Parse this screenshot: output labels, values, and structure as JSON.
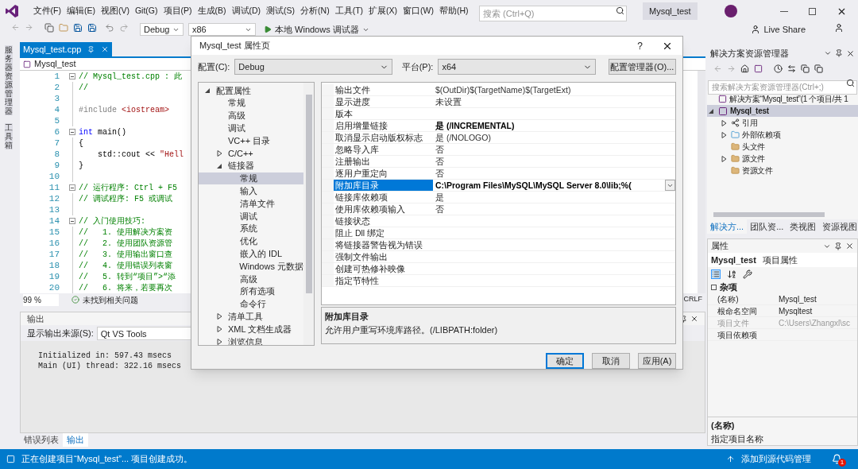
{
  "menu_bar": {
    "items": [
      "文件(F)",
      "编辑(E)",
      "视图(V)",
      "Git(G)",
      "项目(P)",
      "生成(B)",
      "调试(D)",
      "测试(S)",
      "分析(N)",
      "工具(T)",
      "扩展(X)",
      "窗口(W)",
      "帮助(H)"
    ],
    "search": {
      "placeholder": "搜索 (Ctrl+Q)"
    },
    "solution_name": "Mysql_test"
  },
  "toolbar": {
    "configuration": "Debug",
    "platform": "x86",
    "run_button": "本地 Windows 调试器",
    "live_share": "Live Share"
  },
  "side_tabs": [
    "服务器资源管理器",
    "工具箱"
  ],
  "editor": {
    "tabs": [
      {
        "label": "Mysql_test.cpp",
        "selected": true
      }
    ],
    "scope": "Mysql_test",
    "lines": [
      {
        "number": "1",
        "fold": true,
        "segments": [
          {
            "text": "// Mysql_test.cpp : 此",
            "kind": "comment"
          }
        ]
      },
      {
        "number": "2",
        "fold": false,
        "segments": [
          {
            "text": "//",
            "kind": "comment"
          }
        ]
      },
      {
        "number": "3",
        "fold": false
      },
      {
        "number": "4",
        "fold": false,
        "segments": [
          {
            "text": "#include ",
            "kind": "preprocessor"
          },
          {
            "text": "<iostream>",
            "kind": "string"
          }
        ]
      },
      {
        "number": "5",
        "fold": false
      },
      {
        "number": "6",
        "fold": true,
        "segments": [
          {
            "text": "int",
            "kind": "keyword"
          },
          {
            "text": " main()",
            "kind": "plain"
          }
        ]
      },
      {
        "number": "7",
        "fold": false,
        "segments": [
          {
            "text": "{",
            "kind": "plain"
          }
        ]
      },
      {
        "number": "8",
        "fold": false,
        "segments": [
          {
            "text": "    std::cout << ",
            "kind": "plain"
          },
          {
            "text": "\"Hell",
            "kind": "string"
          }
        ]
      },
      {
        "number": "9",
        "fold": false,
        "segments": [
          {
            "text": "}",
            "kind": "plain"
          }
        ]
      },
      {
        "number": "10",
        "fold": false
      },
      {
        "number": "11",
        "fold": true,
        "segments": [
          {
            "text": "// 运行程序: Ctrl + F5",
            "kind": "comment"
          }
        ]
      },
      {
        "number": "12",
        "fold": false,
        "segments": [
          {
            "text": "// 调试程序: F5 或调试",
            "kind": "comment"
          }
        ]
      },
      {
        "number": "13",
        "fold": false
      },
      {
        "number": "14",
        "fold": true,
        "segments": [
          {
            "text": "// 入门使用技巧: ",
            "kind": "comment"
          }
        ]
      },
      {
        "number": "15",
        "fold": false,
        "segments": [
          {
            "text": "//   1. 使用解决方案资",
            "kind": "comment"
          }
        ]
      },
      {
        "number": "16",
        "fold": false,
        "segments": [
          {
            "text": "//   2. 使用团队资源管",
            "kind": "comment"
          }
        ]
      },
      {
        "number": "17",
        "fold": false,
        "segments": [
          {
            "text": "//   3. 使用输出窗口查",
            "kind": "comment"
          }
        ]
      },
      {
        "number": "18",
        "fold": false,
        "segments": [
          {
            "text": "//   4. 使用错误列表窗",
            "kind": "comment"
          }
        ]
      },
      {
        "number": "19",
        "fold": false,
        "segments": [
          {
            "text": "//   5. 转到“项目”>“添",
            "kind": "comment"
          }
        ]
      },
      {
        "number": "20",
        "fold": false,
        "segments": [
          {
            "text": "//   6. 将来，若要再次",
            "kind": "comment"
          }
        ]
      }
    ],
    "zoom": "99 %",
    "issues": "未找到相关问题",
    "line_ending": "CRLF"
  },
  "output": {
    "title": "输出",
    "source_label": "显示输出来源(S):",
    "source": "Qt VS Tools",
    "lines": [
      "Initialized in: 597.43 msecs",
      "Main (UI) thread: 322.16 msecs"
    ]
  },
  "bottom_tabs": [
    {
      "label": "错误列表",
      "selected": false
    },
    {
      "label": "输出",
      "selected": true
    }
  ],
  "dialog": {
    "title": "Mysql_test 属性页",
    "help": "?",
    "config_label": "配置(C):",
    "configuration": "Debug",
    "platform_label": "平台(P):",
    "platform": "x64",
    "config_manager_button": "配置管理器(O)...",
    "tree": [
      {
        "label": "配置属性",
        "selected": false,
        "expanded": true,
        "children": [
          {
            "label": "常规",
            "selected": false
          },
          {
            "label": "高级",
            "selected": false
          },
          {
            "label": "调试",
            "selected": false
          },
          {
            "label": "VC++ 目录",
            "selected": false
          },
          {
            "label": "C/C++",
            "selected": false,
            "expanded": false
          },
          {
            "label": "链接器",
            "selected": false,
            "expanded": true,
            "children": [
              {
                "label": "常规",
                "selected": true
              },
              {
                "label": "输入",
                "selected": false
              },
              {
                "label": "清单文件",
                "selected": false
              },
              {
                "label": "调试",
                "selected": false
              },
              {
                "label": "系统",
                "selected": false
              },
              {
                "label": "优化",
                "selected": false
              },
              {
                "label": "嵌入的 IDL",
                "selected": false
              },
              {
                "label": "Windows 元数据",
                "selected": false
              },
              {
                "label": "高级",
                "selected": false
              },
              {
                "label": "所有选项",
                "selected": false
              },
              {
                "label": "命令行",
                "selected": false
              }
            ]
          },
          {
            "label": "清单工具",
            "selected": false,
            "expanded": false
          },
          {
            "label": "XML 文档生成器",
            "selected": false,
            "expanded": false
          },
          {
            "label": "浏览信息",
            "selected": false,
            "expanded": false
          }
        ]
      }
    ],
    "properties": [
      {
        "name": "输出文件",
        "value": "$(OutDir)$(TargetName)$(TargetExt)",
        "bold": false,
        "selected": false
      },
      {
        "name": "显示进度",
        "value": "未设置",
        "bold": false,
        "selected": false
      },
      {
        "name": "版本",
        "selected": false
      },
      {
        "name": "启用增量链接",
        "value": "是 (/INCREMENTAL)",
        "bold": true,
        "selected": false
      },
      {
        "name": "取消显示启动版权标志",
        "value": "是 (/NOLOGO)",
        "bold": false,
        "selected": false
      },
      {
        "name": "忽略导入库",
        "value": "否",
        "bold": false,
        "selected": false
      },
      {
        "name": "注册输出",
        "value": "否",
        "bold": false,
        "selected": false
      },
      {
        "name": "逐用户重定向",
        "value": "否",
        "bold": false,
        "selected": false
      },
      {
        "name": "附加库目录",
        "value": "C:\\Program Files\\MySQL\\MySQL Server 8.0\\lib;%(",
        "bold": true,
        "selected": true
      },
      {
        "name": "链接库依赖项",
        "value": "是",
        "bold": false,
        "selected": false
      },
      {
        "name": "使用库依赖项输入",
        "value": "否",
        "bold": false,
        "selected": false
      },
      {
        "name": "链接状态",
        "selected": false
      },
      {
        "name": "阻止 Dll 绑定",
        "selected": false
      },
      {
        "name": "将链接器警告视为错误",
        "selected": false
      },
      {
        "name": "强制文件输出",
        "selected": false
      },
      {
        "name": "创建可热修补映像",
        "selected": false
      },
      {
        "name": "指定节特性",
        "selected": false
      }
    ],
    "description": {
      "title": "附加库目录",
      "text": "允许用户重写环境库路径。(/LIBPATH:folder)"
    },
    "buttons": [
      {
        "label": "确定",
        "kind": "default"
      },
      {
        "label": "取消",
        "kind": "normal"
      },
      {
        "label": "应用(A)",
        "kind": "normal"
      }
    ]
  },
  "solution_explorer": {
    "title": "解决方案资源管理器",
    "search": {
      "placeholder": "搜索解决方案资源管理器(Ctrl+;)"
    },
    "tree": [
      {
        "label": "解决方案“Mysql_test”(1 个项目/共 1",
        "kind": "solution",
        "selected": false
      },
      {
        "label": "Mysql_test",
        "kind": "project",
        "selected": true,
        "expanded": true,
        "children": [
          {
            "label": "引用",
            "kind": "references",
            "selected": false,
            "expanded": false
          },
          {
            "label": "外部依赖项",
            "kind": "dependencies",
            "selected": false,
            "expanded": false
          },
          {
            "label": "头文件",
            "kind": "folder",
            "selected": false
          },
          {
            "label": "源文件",
            "kind": "folder",
            "selected": false,
            "expanded": false
          },
          {
            "label": "资源文件",
            "kind": "folder",
            "selected": false
          }
        ]
      }
    ],
    "tabs": [
      {
        "label": "解决方...",
        "selected": true
      },
      {
        "label": "团队资...",
        "selected": false
      },
      {
        "label": "类视图",
        "selected": false
      },
      {
        "label": "资源视图",
        "selected": false
      }
    ]
  },
  "properties_panel": {
    "title": "属性",
    "object": "Mysql_test",
    "object_type": "项目属性",
    "category": "杂项",
    "rows": [
      {
        "name": "(名称)",
        "value": "Mysql_test",
        "disabled": false
      },
      {
        "name": "根命名空间",
        "value": "Mysqltest",
        "disabled": false
      },
      {
        "name": "项目文件",
        "value": "C:\\Users\\Zhangxl\\sc",
        "disabled": true
      },
      {
        "name": "项目依赖项",
        "disabled": false
      }
    ],
    "description": {
      "title": "(名称)",
      "text": "指定项目名称"
    }
  },
  "status_bar": {
    "message": "正在创建项目“Mysql_test”... 项目创建成功。",
    "source_control": "添加到源代码管理",
    "notifications": "1"
  }
}
